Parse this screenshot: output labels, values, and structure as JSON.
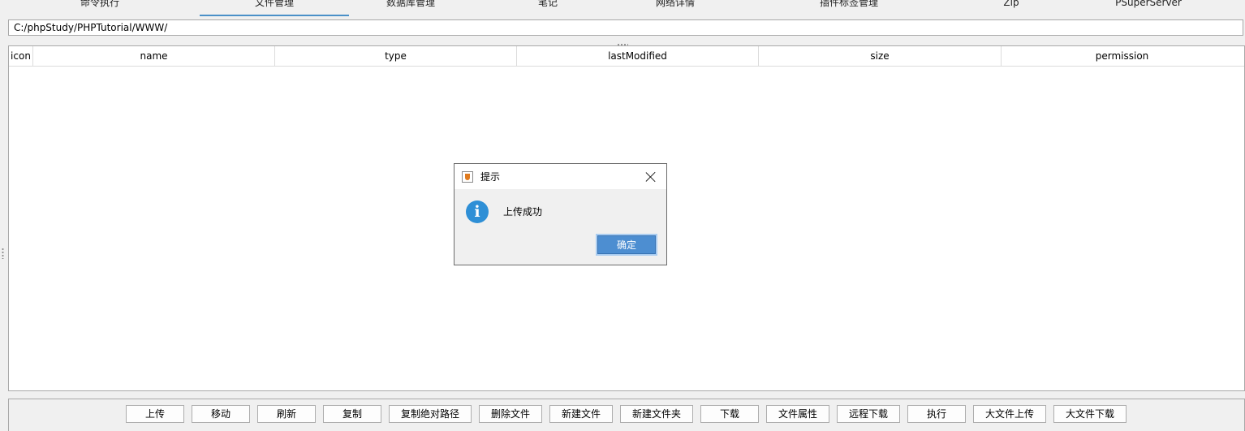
{
  "tabs": [
    {
      "label": "命令执行",
      "active": false
    },
    {
      "label": "文件管理",
      "active": true
    },
    {
      "label": "数据库管理",
      "active": false
    },
    {
      "label": "笔记",
      "active": false
    },
    {
      "label": "网络详情",
      "active": false
    },
    {
      "label": "插件标签管理",
      "active": false
    },
    {
      "label": "Zip",
      "active": false
    },
    {
      "label": "PSuperServer",
      "active": false
    }
  ],
  "path": {
    "value": "C:/phpStudy/PHPTutorial/WWW/"
  },
  "table": {
    "columns": [
      "icon",
      "name",
      "type",
      "lastModified",
      "size",
      "permission"
    ],
    "rows": []
  },
  "buttons": [
    "上传",
    "移动",
    "刷新",
    "复制",
    "复制绝对路径",
    "删除文件",
    "新建文件",
    "新建文件夹",
    "下载",
    "文件属性",
    "远程下载",
    "执行",
    "大文件上传",
    "大文件下载"
  ],
  "dialog": {
    "title": "提示",
    "message": "上传成功",
    "ok_label": "确定"
  }
}
